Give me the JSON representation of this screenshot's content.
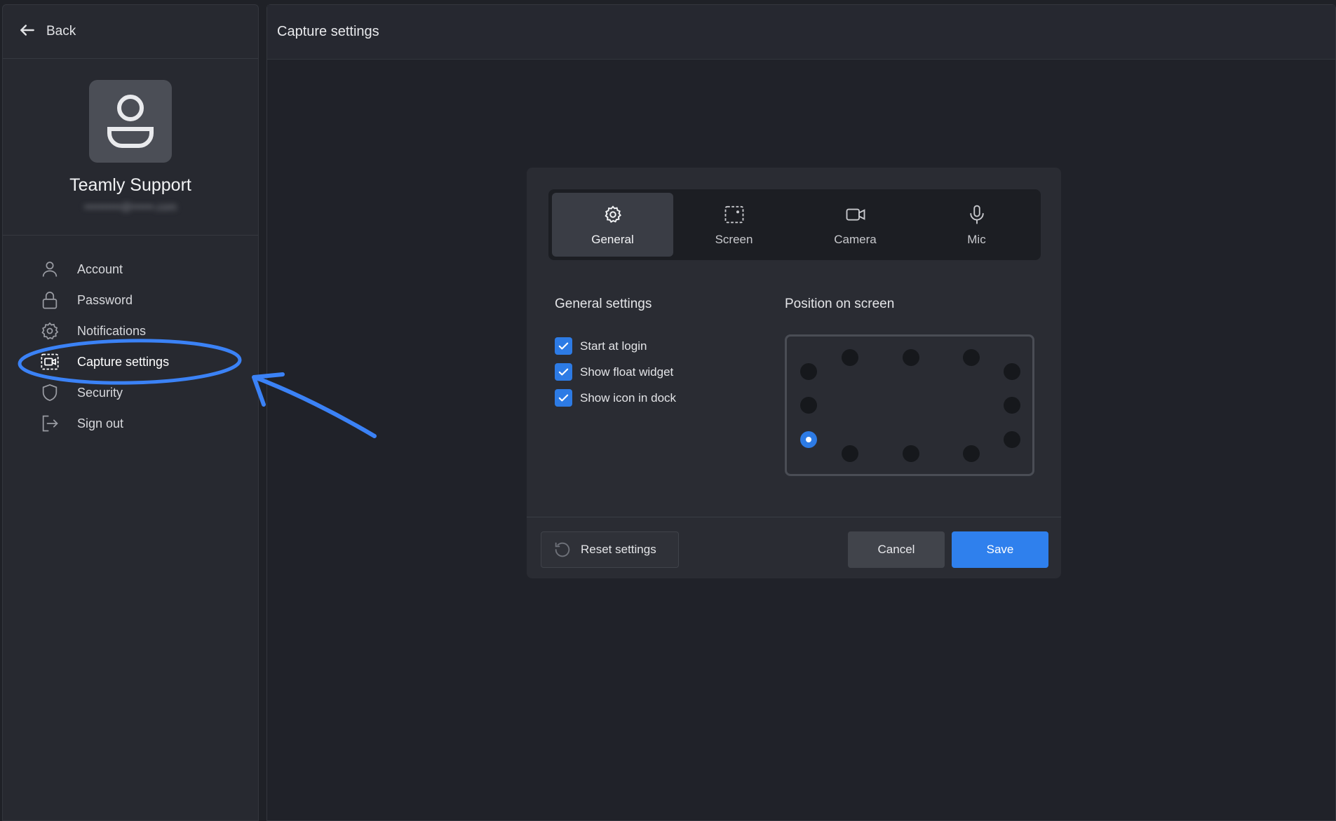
{
  "sidebar": {
    "back_label": "Back",
    "profile": {
      "name": "Teamly Support",
      "email": "••••••••••@••••••.com"
    },
    "items": [
      {
        "label": "Account",
        "icon": "user-icon"
      },
      {
        "label": "Password",
        "icon": "lock-icon"
      },
      {
        "label": "Notifications",
        "icon": "gear-icon"
      },
      {
        "label": "Capture settings",
        "icon": "capture-icon",
        "active": true
      },
      {
        "label": "Security",
        "icon": "shield-icon"
      },
      {
        "label": "Sign out",
        "icon": "sign-out-icon"
      }
    ]
  },
  "main": {
    "title": "Capture settings"
  },
  "dialog": {
    "tabs": [
      {
        "label": "General",
        "icon": "gear-icon",
        "active": true
      },
      {
        "label": "Screen",
        "icon": "screen-icon"
      },
      {
        "label": "Camera",
        "icon": "camera-icon"
      },
      {
        "label": "Mic",
        "icon": "mic-icon"
      }
    ],
    "general_title": "General settings",
    "position_title": "Position on screen",
    "checkboxes": [
      {
        "label": "Start at login",
        "checked": true
      },
      {
        "label": "Show float widget",
        "checked": true
      },
      {
        "label": "Show icon in dock",
        "checked": true
      }
    ],
    "position_selected": "left-lower",
    "footer": {
      "reset_label": "Reset settings",
      "cancel_label": "Cancel",
      "save_label": "Save"
    }
  },
  "colors": {
    "accent": "#2f80ed",
    "annotation": "#3b82f6",
    "background": "#1f2127"
  }
}
